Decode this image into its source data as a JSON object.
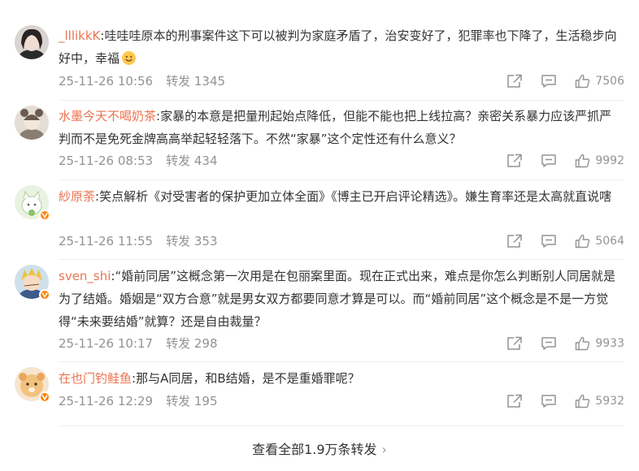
{
  "comments": [
    {
      "user": "_lllikkK",
      "text": ":哇哇哇原本的刑事案件这下可以被判为家庭矛盾了，治安变好了，犯罪率也下降了，生活稳步向好中，幸福",
      "emoji": "smile-emoji",
      "time": "25-11-26 10:56",
      "repost": "转发 1345",
      "likes": "7506"
    },
    {
      "user": "水墨今天不喝奶茶",
      "text": ":家暴的本意是把量刑起始点降低，但能不能也把上线拉高？亲密关系暴力应该严抓严判而不是免死金牌高高举起轻轻落下。不然“家暴”这个定性还有什么意义？",
      "time": "25-11-26 08:53",
      "repost": "转发 434",
      "likes": "9992"
    },
    {
      "user": "紗原荼",
      "text": ":笑点解析《对受害者的保护更加立体全面》《博主已开启评论精选》。嫌生育率还是太高就直说嗐",
      "time": "25-11-26 11:55",
      "repost": "转发 353",
      "likes": "5064"
    },
    {
      "user": "sven_shi",
      "text": ":“婚前同居”这概念第一次用是在包丽案里面。现在正式出来，难点是你怎么判断别人同居就是为了结婚。婚姻是“双方合意”就是男女双方都要同意才算是可以。而“婚前同居”这个概念是不是一方觉得“未来要结婚”就算？还是自由裁量？",
      "time": "25-11-26 10:17",
      "repost": "转发 298",
      "likes": "9933"
    },
    {
      "user": "在也门钓鲑鱼",
      "text": ":那与A同居，和B结婚，是不是重婚罪呢？",
      "time": "25-11-26 12:29",
      "repost": "转发 195",
      "likes": "5932"
    }
  ],
  "footer": {
    "more_label": "查看全部1.9万条转发",
    "chevron": "›"
  },
  "colors": {
    "username": "#eb7350",
    "meta": "#939393",
    "badge": "#ff8200"
  }
}
